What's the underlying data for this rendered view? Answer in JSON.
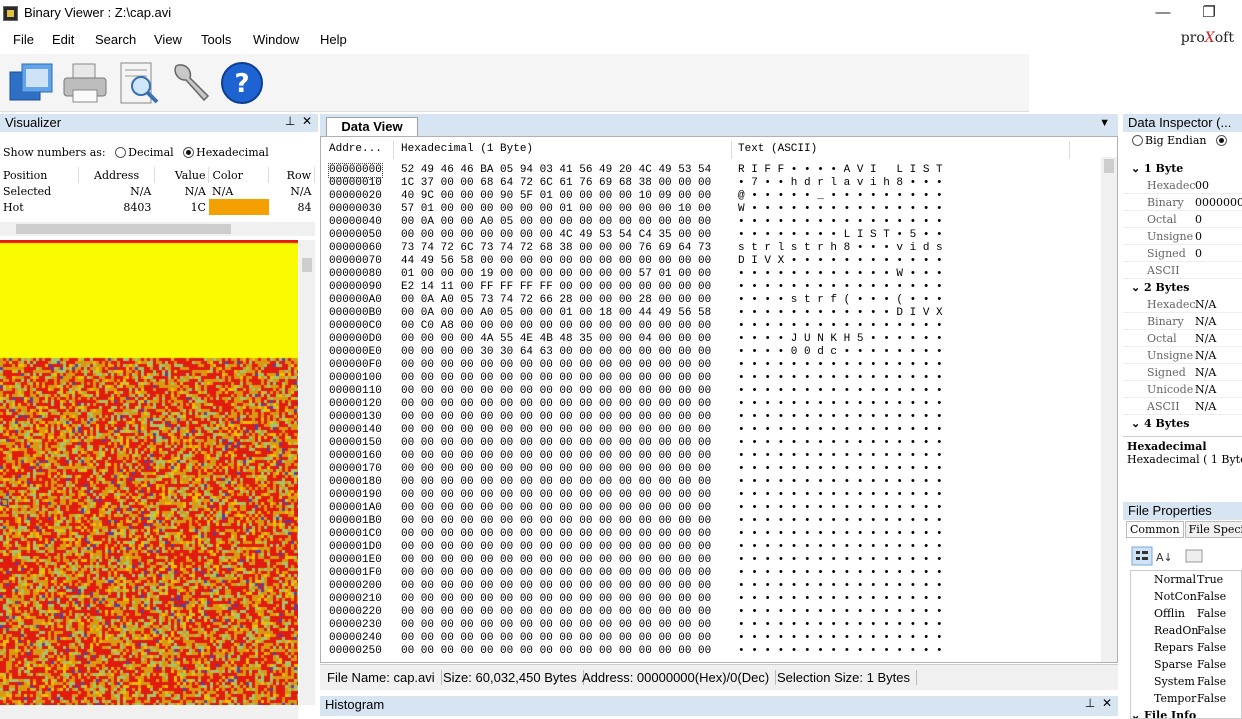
{
  "window": {
    "title": "Binary Viewer : Z:\\cap.avi",
    "minimize": "—",
    "restore": "❐",
    "close": "✕"
  },
  "menu": [
    "File",
    "Edit",
    "Search",
    "View",
    "Tools",
    "Window",
    "Help"
  ],
  "brand": {
    "pre": "pro",
    "x": "X",
    "post": "oft"
  },
  "toolbar": {
    "tools": [
      "open-icon",
      "print-icon",
      "preview-icon",
      "settings-wrench-icon",
      "help-icon"
    ]
  },
  "visualizer": {
    "title": "Visualizer",
    "pin": "📌",
    "close": "✕",
    "show_numbers_label": "Show numbers as:",
    "decimal": "Decimal",
    "hexadecimal": "Hexadecimal",
    "columns": [
      "Position",
      "Address",
      "Value",
      "Color",
      "Row"
    ],
    "rows": [
      {
        "position": "Selected",
        "address": "N/A",
        "value": "N/A",
        "color": "N/A",
        "row": "N/A"
      },
      {
        "position": "Hot",
        "address": "8403",
        "value": "1C",
        "color": "",
        "row": "84"
      }
    ],
    "hot_color": "#f4a000"
  },
  "dataview": {
    "tab": "Data View",
    "header_address": "Addre...",
    "header_hex": "Hexadecimal (1 Byte)",
    "header_text": "Text (ASCII)",
    "rows": [
      {
        "a": "00000000",
        "h": "52 49 46 46 BA 05 94 03 41 56 49 20 4C 49 53 54",
        "t": "R I F F • • • • A V I   L I S T"
      },
      {
        "a": "00000010",
        "h": "1C 37 00 00 68 64 72 6C 61 76 69 68 38 00 00 00",
        "t": "• 7 • • h d r l a v i h 8 • • •"
      },
      {
        "a": "00000020",
        "h": "40 9C 00 00 00 90 5F 01 00 00 00 00 10 09 00 00",
        "t": "@ • • • • • _ • • • • • • • • •"
      },
      {
        "a": "00000030",
        "h": "57 01 00 00 00 00 00 00 01 00 00 00 00 00 10 00",
        "t": "W • • • • • • • • • • • • • • •"
      },
      {
        "a": "00000040",
        "h": "00 0A 00 00 A0 05 00 00 00 00 00 00 00 00 00 00",
        "t": "• • • • • • • • • • • • • • • •"
      },
      {
        "a": "00000050",
        "h": "00 00 00 00 00 00 00 00 4C 49 53 54 C4 35 00 00",
        "t": "• • • • • • • • L I S T • 5 • •"
      },
      {
        "a": "00000060",
        "h": "73 74 72 6C 73 74 72 68 38 00 00 00 76 69 64 73",
        "t": "s t r l s t r h 8 • • • v i d s"
      },
      {
        "a": "00000070",
        "h": "44 49 56 58 00 00 00 00 00 00 00 00 00 00 00 00",
        "t": "D I V X • • • • • • • • • • • •"
      },
      {
        "a": "00000080",
        "h": "01 00 00 00 19 00 00 00 00 00 00 00 57 01 00 00",
        "t": "• • • • • • • • • • • • W • • •"
      },
      {
        "a": "00000090",
        "h": "E2 14 11 00 FF FF FF FF 00 00 00 00 00 00 00 00",
        "t": "• • • • • • • • • • • • • • • •"
      },
      {
        "a": "000000A0",
        "h": "00 0A A0 05 73 74 72 66 28 00 00 00 28 00 00 00",
        "t": "• • • • s t r f ( • • • ( • • •"
      },
      {
        "a": "000000B0",
        "h": "00 0A 00 00 A0 05 00 00 01 00 18 00 44 49 56 58",
        "t": "• • • • • • • • • • • • D I V X"
      },
      {
        "a": "000000C0",
        "h": "00 C0 A8 00 00 00 00 00 00 00 00 00 00 00 00 00",
        "t": "• • • • • • • • • • • • • • • •"
      },
      {
        "a": "000000D0",
        "h": "00 00 00 00 4A 55 4E 4B 48 35 00 00 04 00 00 00",
        "t": "• • • • J U N K H 5 • • • • • •"
      },
      {
        "a": "000000E0",
        "h": "00 00 00 00 30 30 64 63 00 00 00 00 00 00 00 00",
        "t": "• • • • 0 0 d c • • • • • • • •"
      },
      {
        "a": "000000F0",
        "h": "00 00 00 00 00 00 00 00 00 00 00 00 00 00 00 00",
        "t": "• • • • • • • • • • • • • • • •"
      },
      {
        "a": "00000100",
        "h": "00 00 00 00 00 00 00 00 00 00 00 00 00 00 00 00",
        "t": "• • • • • • • • • • • • • • • •"
      },
      {
        "a": "00000110",
        "h": "00 00 00 00 00 00 00 00 00 00 00 00 00 00 00 00",
        "t": "• • • • • • • • • • • • • • • •"
      },
      {
        "a": "00000120",
        "h": "00 00 00 00 00 00 00 00 00 00 00 00 00 00 00 00",
        "t": "• • • • • • • • • • • • • • • •"
      },
      {
        "a": "00000130",
        "h": "00 00 00 00 00 00 00 00 00 00 00 00 00 00 00 00",
        "t": "• • • • • • • • • • • • • • • •"
      },
      {
        "a": "00000140",
        "h": "00 00 00 00 00 00 00 00 00 00 00 00 00 00 00 00",
        "t": "• • • • • • • • • • • • • • • •"
      },
      {
        "a": "00000150",
        "h": "00 00 00 00 00 00 00 00 00 00 00 00 00 00 00 00",
        "t": "• • • • • • • • • • • • • • • •"
      },
      {
        "a": "00000160",
        "h": "00 00 00 00 00 00 00 00 00 00 00 00 00 00 00 00",
        "t": "• • • • • • • • • • • • • • • •"
      },
      {
        "a": "00000170",
        "h": "00 00 00 00 00 00 00 00 00 00 00 00 00 00 00 00",
        "t": "• • • • • • • • • • • • • • • •"
      },
      {
        "a": "00000180",
        "h": "00 00 00 00 00 00 00 00 00 00 00 00 00 00 00 00",
        "t": "• • • • • • • • • • • • • • • •"
      },
      {
        "a": "00000190",
        "h": "00 00 00 00 00 00 00 00 00 00 00 00 00 00 00 00",
        "t": "• • • • • • • • • • • • • • • •"
      },
      {
        "a": "000001A0",
        "h": "00 00 00 00 00 00 00 00 00 00 00 00 00 00 00 00",
        "t": "• • • • • • • • • • • • • • • •"
      },
      {
        "a": "000001B0",
        "h": "00 00 00 00 00 00 00 00 00 00 00 00 00 00 00 00",
        "t": "• • • • • • • • • • • • • • • •"
      },
      {
        "a": "000001C0",
        "h": "00 00 00 00 00 00 00 00 00 00 00 00 00 00 00 00",
        "t": "• • • • • • • • • • • • • • • •"
      },
      {
        "a": "000001D0",
        "h": "00 00 00 00 00 00 00 00 00 00 00 00 00 00 00 00",
        "t": "• • • • • • • • • • • • • • • •"
      },
      {
        "a": "000001E0",
        "h": "00 00 00 00 00 00 00 00 00 00 00 00 00 00 00 00",
        "t": "• • • • • • • • • • • • • • • •"
      },
      {
        "a": "000001F0",
        "h": "00 00 00 00 00 00 00 00 00 00 00 00 00 00 00 00",
        "t": "• • • • • • • • • • • • • • • •"
      },
      {
        "a": "00000200",
        "h": "00 00 00 00 00 00 00 00 00 00 00 00 00 00 00 00",
        "t": "• • • • • • • • • • • • • • • •"
      },
      {
        "a": "00000210",
        "h": "00 00 00 00 00 00 00 00 00 00 00 00 00 00 00 00",
        "t": "• • • • • • • • • • • • • • • •"
      },
      {
        "a": "00000220",
        "h": "00 00 00 00 00 00 00 00 00 00 00 00 00 00 00 00",
        "t": "• • • • • • • • • • • • • • • •"
      },
      {
        "a": "00000230",
        "h": "00 00 00 00 00 00 00 00 00 00 00 00 00 00 00 00",
        "t": "• • • • • • • • • • • • • • • •"
      },
      {
        "a": "00000240",
        "h": "00 00 00 00 00 00 00 00 00 00 00 00 00 00 00 00",
        "t": "• • • • • • • • • • • • • • • •"
      },
      {
        "a": "00000250",
        "h": "00 00 00 00 00 00 00 00 00 00 00 00 00 00 00 00",
        "t": "• • • • • • • • • • • • • • • •"
      }
    ]
  },
  "status": {
    "file_name": "File Name: cap.avi",
    "size": "Size: 60,032,450 Bytes",
    "address": "Address: 00000000(Hex)/0(Dec)",
    "selection": "Selection Size: 1 Bytes"
  },
  "histogram": {
    "title": "Histogram"
  },
  "inspector": {
    "title": "Data Inspector (...",
    "big_endian": "Big Endian",
    "groups": [
      {
        "name": "1 Byte",
        "rows": [
          [
            "Hexadec",
            "00"
          ],
          [
            "Binary",
            "00000000"
          ],
          [
            "Octal",
            "0"
          ],
          [
            "Unsigne",
            "0"
          ],
          [
            "Signed",
            "0"
          ],
          [
            "ASCII",
            ""
          ]
        ]
      },
      {
        "name": "2 Bytes",
        "rows": [
          [
            "Hexadec",
            "N/A"
          ],
          [
            "Binary",
            "N/A"
          ],
          [
            "Octal",
            "N/A"
          ],
          [
            "Unsigne",
            "N/A"
          ],
          [
            "Signed",
            "N/A"
          ],
          [
            "Unicode",
            "N/A"
          ],
          [
            "ASCII",
            "N/A"
          ]
        ]
      },
      {
        "name": "4 Bytes",
        "rows": []
      }
    ],
    "desc_title": "Hexadecimal",
    "desc_text": "Hexadecimal ( 1 Byte"
  },
  "file_properties": {
    "title": "File Properties",
    "tabs": [
      "Common",
      "File Specifi"
    ],
    "rows": [
      [
        "Normal",
        "True"
      ],
      [
        "NotCon",
        "False"
      ],
      [
        "Offlin",
        "False"
      ],
      [
        "ReadOn",
        "False"
      ],
      [
        "Repars",
        "False"
      ],
      [
        "Sparse",
        "False"
      ],
      [
        "System",
        "False"
      ],
      [
        "Tempor",
        "False"
      ]
    ],
    "group": "File Info"
  }
}
